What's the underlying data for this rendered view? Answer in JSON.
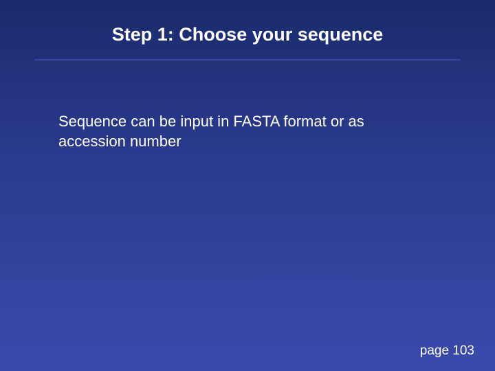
{
  "slide": {
    "title": "Step 1: Choose your sequence",
    "body": "Sequence can be input in FASTA format or as accession number",
    "page_label": "page 103"
  }
}
